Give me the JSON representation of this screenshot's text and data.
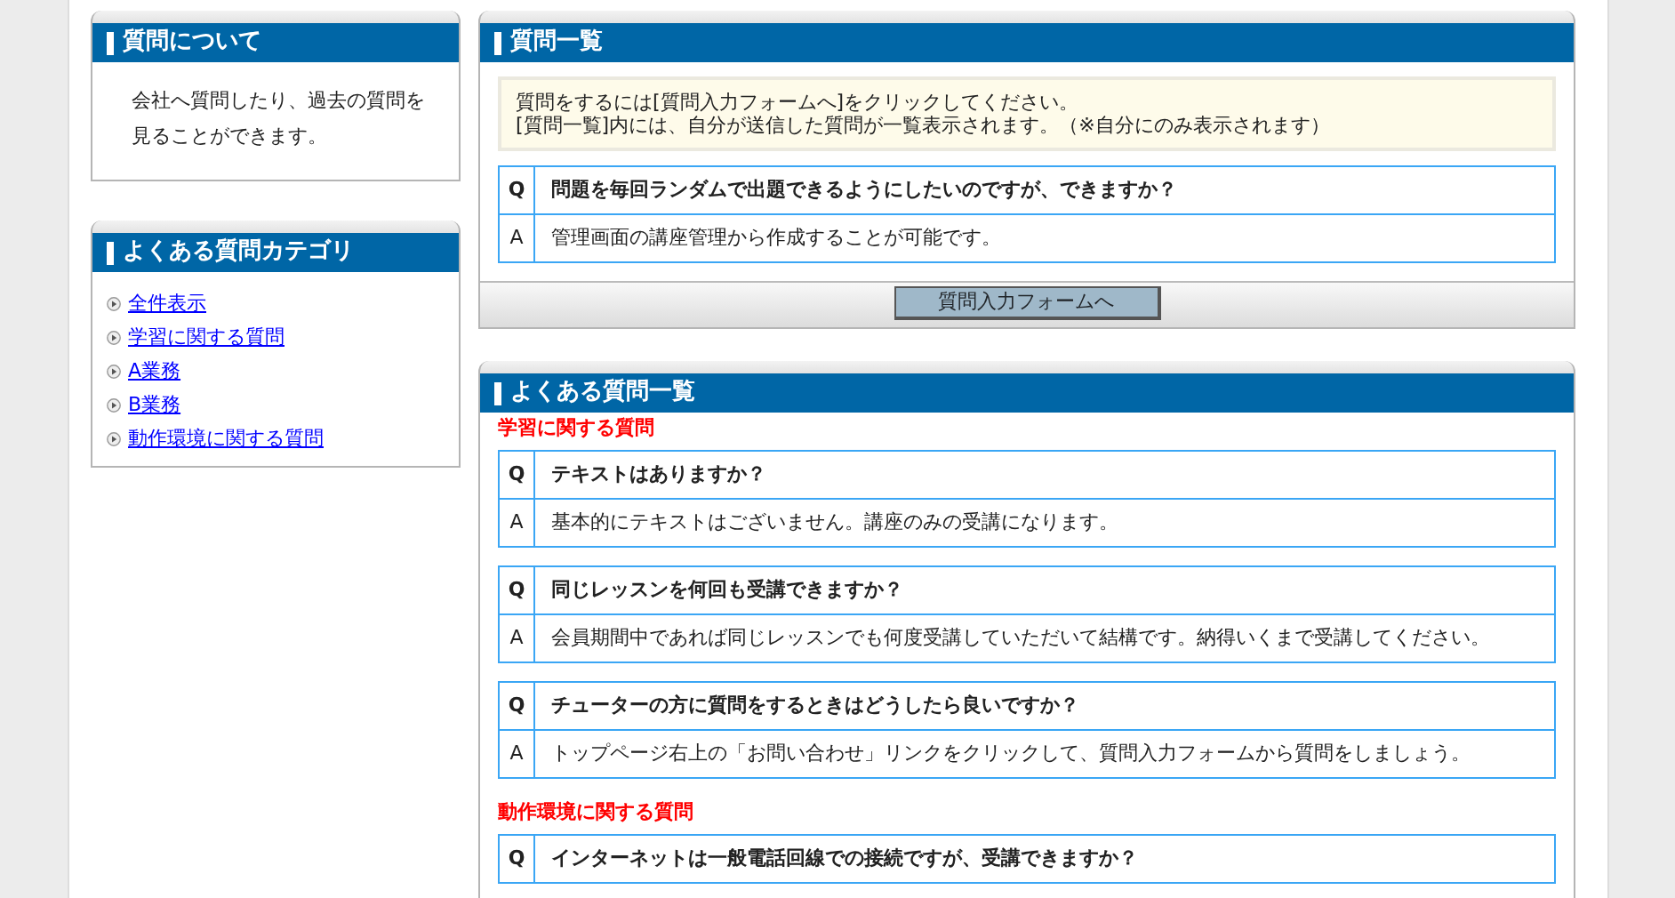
{
  "about": {
    "title": "質問について",
    "text": "会社へ質問したり、過去の質問を見ることができます。"
  },
  "categories": {
    "title": "よくある質問カテゴリ",
    "items": [
      {
        "label": "全件表示"
      },
      {
        "label": "学習に関する質問"
      },
      {
        "label": "A業務"
      },
      {
        "label": "B業務"
      },
      {
        "label": "動作環境に関する質問"
      }
    ]
  },
  "question_list": {
    "title": "質問一覧",
    "notice": [
      "質問をするには[質問入力フォームへ]をクリックしてください。",
      "[質問一覧]内には、自分が送信した質問が一覧表示されます。（※自分にのみ表示されます）"
    ],
    "items": [
      {
        "q_mark": "Q",
        "question": "問題を毎回ランダムで出題できるようにしたいのですが、できますか？",
        "a_mark": "A",
        "answer": "管理画面の講座管理から作成することが可能です。"
      }
    ],
    "button": "質問入力フォームへ"
  },
  "faq": {
    "title": "よくある質問一覧",
    "groups": [
      {
        "heading": "学習に関する質問",
        "items": [
          {
            "q_mark": "Q",
            "question": "テキストはありますか？",
            "a_mark": "A",
            "answer": "基本的にテキストはございません。講座のみの受講になります。"
          },
          {
            "q_mark": "Q",
            "question": "同じレッスンを何回も受講できますか？",
            "a_mark": "A",
            "answer": "会員期間中であれば同じレッスンでも何度受講していただいて結構です。納得いくまで受講してください。"
          },
          {
            "q_mark": "Q",
            "question": "チューターの方に質問をするときはどうしたら良いですか？",
            "a_mark": "A",
            "answer": "トップページ右上の「お問い合わせ」リンクをクリックして、質問入力フォームから質問をしましょう。"
          }
        ]
      },
      {
        "heading": "動作環境に関する質問",
        "items": [
          {
            "q_mark": "Q",
            "question": "インターネットは一般電話回線での接続ですが、受講できますか？"
          }
        ]
      }
    ]
  }
}
